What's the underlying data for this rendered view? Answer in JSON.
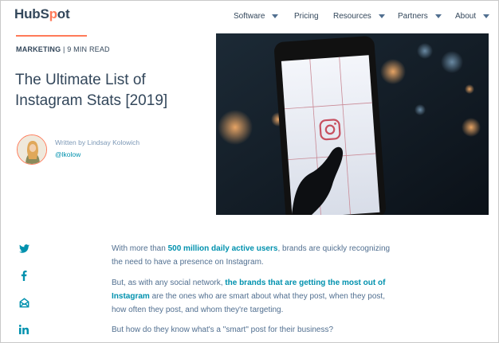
{
  "header": {
    "logo_pre": "HubS",
    "logo_o": "p",
    "logo_post": "ot",
    "nav": [
      {
        "label": "Software"
      },
      {
        "label": "Pricing"
      },
      {
        "label": "Resources"
      },
      {
        "label": "Partners"
      },
      {
        "label": "About"
      }
    ]
  },
  "article": {
    "category": "MARKETING",
    "separator": "|",
    "read_time": "9 MIN READ",
    "title": "The Ultimate List of Instagram Stats [2019]",
    "author_line": "Written by Lindsay Kolowich",
    "author_handle": "@lkolow"
  },
  "share": [
    "twitter-icon",
    "facebook-icon",
    "email-icon",
    "linkedin-icon"
  ],
  "body": {
    "p1_before": "With more than ",
    "p1_link": "500 million daily active users",
    "p1_after": ", brands are quickly recognizing the need to have a presence on Instagram.",
    "p2_before": "But, as with any social network, ",
    "p2_link": "the brands that are getting the most out of Instagram",
    "p2_after": " are the ones who are smart about what they post, when they post, how often they post, and whom they're targeting.",
    "p3": "But how do they know what's a \"smart\" post for their business?"
  },
  "colors": {
    "accent": "#ff7a59",
    "link": "#0091ae",
    "text": "#33475b"
  }
}
